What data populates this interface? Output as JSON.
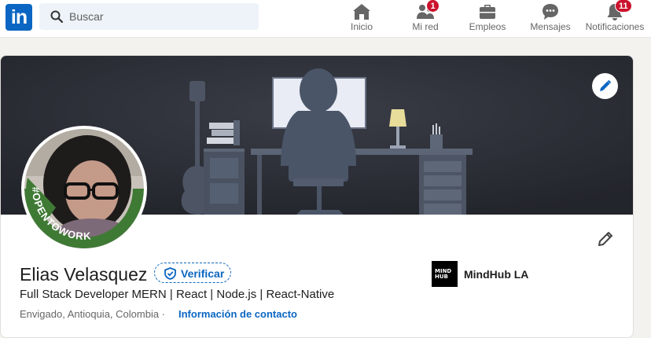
{
  "header": {
    "logo_text": "in",
    "search_placeholder": "Buscar",
    "nav": [
      {
        "label": "Inicio",
        "icon": "home-icon",
        "badge": ""
      },
      {
        "label": "Mi red",
        "icon": "people-icon",
        "badge": "1"
      },
      {
        "label": "Empleos",
        "icon": "briefcase-icon",
        "badge": ""
      },
      {
        "label": "Mensajes",
        "icon": "chat-icon",
        "badge": ""
      },
      {
        "label": "Notificaciones",
        "icon": "bell-icon",
        "badge": "11"
      }
    ]
  },
  "profile": {
    "name": "Elias Velasquez",
    "verify_label": "Verificar",
    "headline": "Full Stack Developer MERN | React | Node.js | React-Native",
    "location": "Envigado, Antioquia, Colombia ·",
    "contact_link": "Información de contacto",
    "open_to_work_badge": "#OPENTOWORK",
    "company": {
      "name": "MindHub LA",
      "logo_text": "MIND HUB"
    }
  },
  "colors": {
    "brand": "#0a66c2",
    "badge_red": "#cb112d",
    "open_to_work_green": "#3f7a35",
    "banner_dark": "#2b2e36"
  }
}
